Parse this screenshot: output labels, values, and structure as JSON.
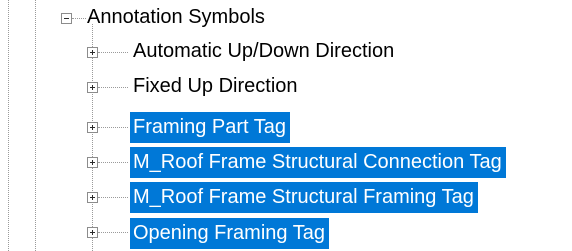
{
  "tree": {
    "root": {
      "label": "Annotation Symbols",
      "expander": "minus",
      "children": [
        {
          "label": "Automatic Up/Down Direction",
          "expander": "plus",
          "selected": false
        },
        {
          "label": "Fixed Up Direction",
          "expander": "plus",
          "selected": false
        },
        {
          "label": "Framing Part Tag",
          "expander": "plus",
          "selected": true
        },
        {
          "label": "M_Roof Frame Structural Connection Tag",
          "expander": "plus",
          "selected": true
        },
        {
          "label": "M_Roof Frame Structural Framing Tag",
          "expander": "plus",
          "selected": true
        },
        {
          "label": "Opening Framing Tag",
          "expander": "plus",
          "selected": true
        }
      ]
    }
  },
  "colors": {
    "selection_background": "#0078d7",
    "selection_text": "#ffffff",
    "connector_lines": "#9a9a9a"
  }
}
